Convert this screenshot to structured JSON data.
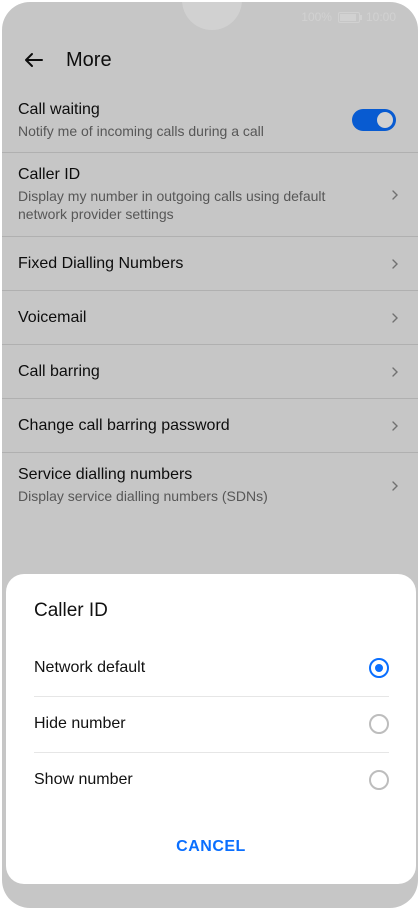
{
  "status": {
    "battery_percent": "100%",
    "time": "10:00"
  },
  "header": {
    "title": "More"
  },
  "settings": [
    {
      "title": "Call waiting",
      "subtitle": "Notify me of incoming calls during a call",
      "control": "toggle-on"
    },
    {
      "title": "Caller ID",
      "subtitle": "Display my number in outgoing calls using default network provider settings",
      "control": "chevron"
    },
    {
      "title": "Fixed Dialling Numbers",
      "subtitle": "",
      "control": "chevron"
    },
    {
      "title": "Voicemail",
      "subtitle": "",
      "control": "chevron"
    },
    {
      "title": "Call barring",
      "subtitle": "",
      "control": "chevron"
    },
    {
      "title": "Change call barring password",
      "subtitle": "",
      "control": "chevron"
    },
    {
      "title": "Service dialling numbers",
      "subtitle": "Display service dialling numbers (SDNs)",
      "control": "chevron"
    }
  ],
  "dialog": {
    "title": "Caller ID",
    "options": [
      {
        "label": "Network default",
        "selected": true
      },
      {
        "label": "Hide number",
        "selected": false
      },
      {
        "label": "Show number",
        "selected": false
      }
    ],
    "cancel_label": "CANCEL"
  },
  "colors": {
    "accent": "#0a6fff",
    "background": "#f2f2f2",
    "text": "#111111",
    "secondary_text": "#6b6b6b"
  }
}
